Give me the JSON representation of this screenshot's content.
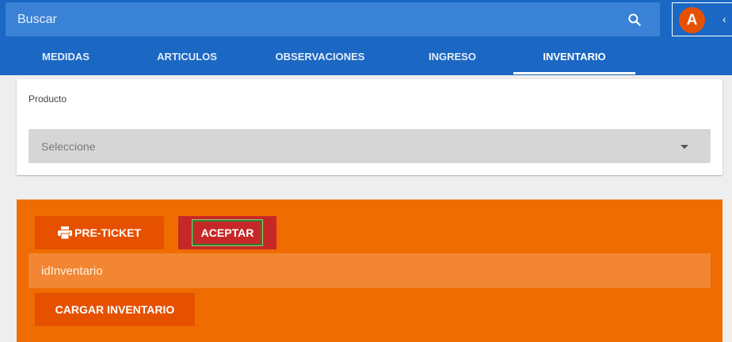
{
  "header": {
    "search_placeholder": "Buscar",
    "search_icon": "search-icon",
    "avatar_letter": "A",
    "collapse_icon": "chevron-left-icon",
    "brand_color": "#1b67c4",
    "avatar_color": "#e65100"
  },
  "tabs": [
    {
      "label": "MEDIDAS"
    },
    {
      "label": "ARTICULOS"
    },
    {
      "label": "OBSERVACIONES"
    },
    {
      "label": "INGRESO"
    },
    {
      "label": "INVENTARIO",
      "active": true
    }
  ],
  "product_card": {
    "label": "Producto",
    "select_placeholder": "Seleccione"
  },
  "actions_panel": {
    "background": "#ef6c00",
    "preticket_label": "PRE-TICKET",
    "preticket_icon": "printer-icon",
    "aceptar_label": "ACEPTAR",
    "id_inventario_placeholder": "idInventario",
    "cargar_label": "CARGAR INVENTARIO"
  }
}
